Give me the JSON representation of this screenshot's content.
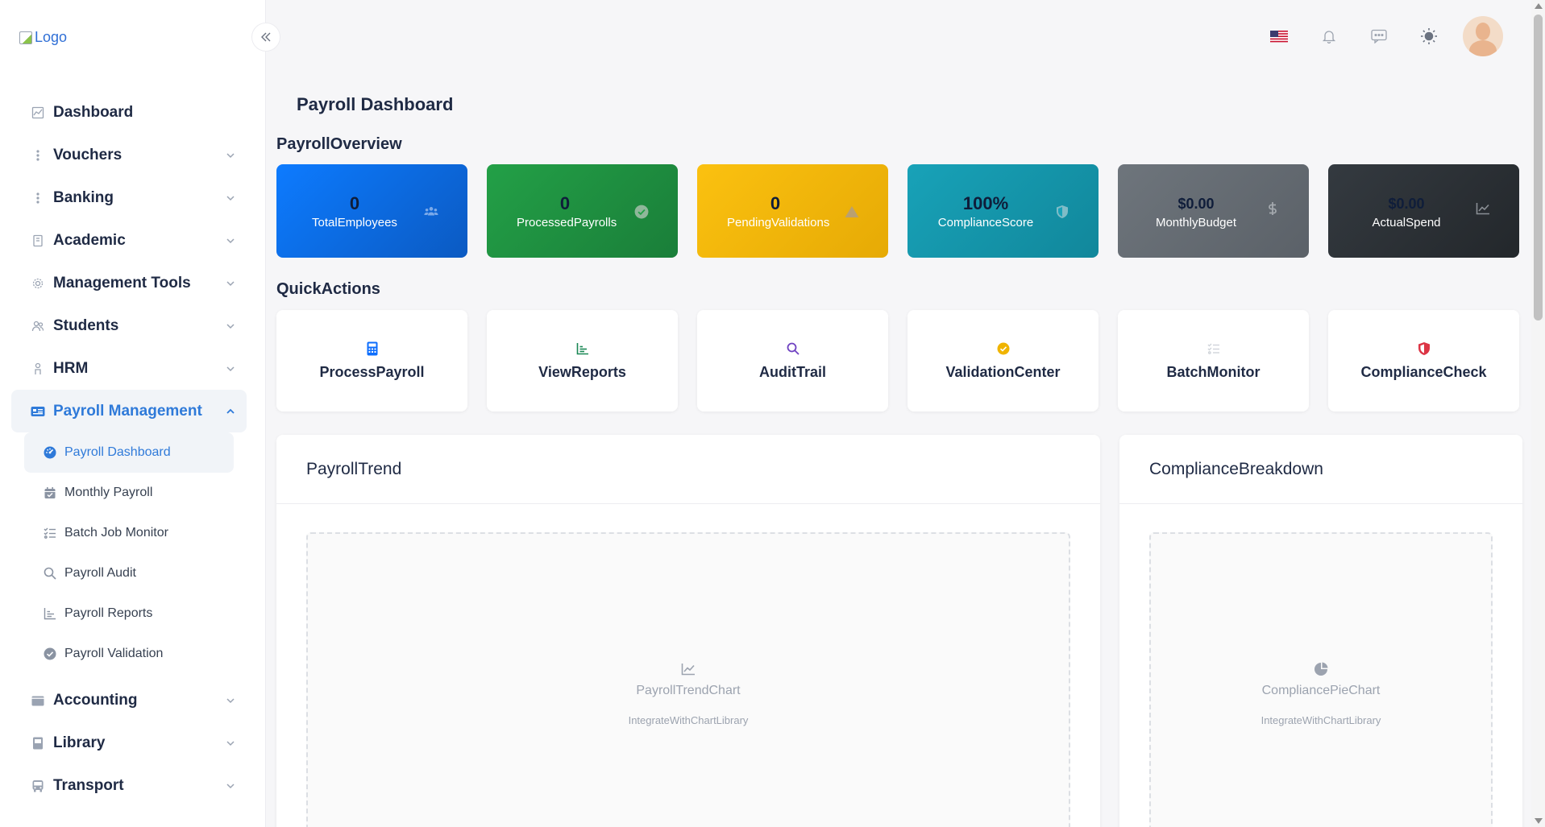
{
  "logo": {
    "alt": "Logo"
  },
  "sidebar": {
    "items": [
      {
        "label": "Dashboard",
        "icon": "chart-icon",
        "has_children": false
      },
      {
        "label": "Vouchers",
        "icon": "dots-vertical-icon",
        "has_children": true
      },
      {
        "label": "Banking",
        "icon": "dots-vertical-icon",
        "has_children": true
      },
      {
        "label": "Academic",
        "icon": "book-icon",
        "has_children": true
      },
      {
        "label": "Management Tools",
        "icon": "gear-icon",
        "has_children": true
      },
      {
        "label": "Students",
        "icon": "students-icon",
        "has_children": true
      },
      {
        "label": "HRM",
        "icon": "person-icon",
        "has_children": true
      },
      {
        "label": "Payroll Management",
        "icon": "id-card-icon",
        "has_children": true,
        "expanded": true
      },
      {
        "label": "Accounting",
        "icon": "wallet-icon",
        "has_children": true
      },
      {
        "label": "Library",
        "icon": "library-book-icon",
        "has_children": true
      },
      {
        "label": "Transport",
        "icon": "bus-icon",
        "has_children": true
      }
    ],
    "payroll_sub": [
      {
        "label": "Payroll Dashboard",
        "icon": "gauge-icon",
        "active": true
      },
      {
        "label": "Monthly Payroll",
        "icon": "calendar-icon"
      },
      {
        "label": "Batch Job Monitor",
        "icon": "tasks-icon"
      },
      {
        "label": "Payroll Audit",
        "icon": "search-icon"
      },
      {
        "label": "Payroll Reports",
        "icon": "bar-chart-icon"
      },
      {
        "label": "Payroll Validation",
        "icon": "check-circle-icon"
      }
    ]
  },
  "header": {
    "icons": [
      "us-flag-icon",
      "bell-icon",
      "chat-icon",
      "sun-icon",
      "avatar"
    ]
  },
  "main": {
    "title": "Payroll Dashboard",
    "overview_title": "PayrollOverview",
    "stats": [
      {
        "value": "0",
        "label": "TotalEmployees",
        "icon": "users-icon",
        "color": "#0d6efd"
      },
      {
        "value": "0",
        "label": "ProcessedPayrolls",
        "icon": "check-circle-icon",
        "color": "#198754"
      },
      {
        "value": "0",
        "label": "PendingValidations",
        "icon": "warning-triangle-icon",
        "color": "#f0b400"
      },
      {
        "value": "100%",
        "label": "ComplianceScore",
        "icon": "shield-icon",
        "color": "#1491a8"
      },
      {
        "value": "$0.00",
        "label": "MonthlyBudget",
        "icon": "dollar-icon",
        "color": "#6c737b"
      },
      {
        "value": "$0.00",
        "label": "ActualSpend",
        "icon": "line-chart-icon",
        "color": "#2b3038"
      }
    ],
    "quick_title": "QuickActions",
    "actions": [
      {
        "label": "ProcessPayroll",
        "icon": "calculator-icon",
        "color": "#0d6efd"
      },
      {
        "label": "ViewReports",
        "icon": "bar-chart-icon",
        "color": "#198754"
      },
      {
        "label": "AuditTrail",
        "icon": "search-icon",
        "color": "#6f42c1"
      },
      {
        "label": "ValidationCenter",
        "icon": "check-circle-icon",
        "color": "#f0b400"
      },
      {
        "label": "BatchMonitor",
        "icon": "tasks-icon",
        "color": "#d0d4da"
      },
      {
        "label": "ComplianceCheck",
        "icon": "shield-icon",
        "color": "#dc3545"
      }
    ],
    "trend_panel": {
      "title": "PayrollTrend",
      "chart_title": "PayrollTrendChart",
      "chart_sub": "IntegrateWithChartLibrary",
      "icon": "line-chart-icon"
    },
    "compliance_panel": {
      "title": "ComplianceBreakdown",
      "chart_title": "CompliancePieChart",
      "chart_sub": "IntegrateWithChartLibrary",
      "icon": "pie-chart-icon"
    }
  }
}
